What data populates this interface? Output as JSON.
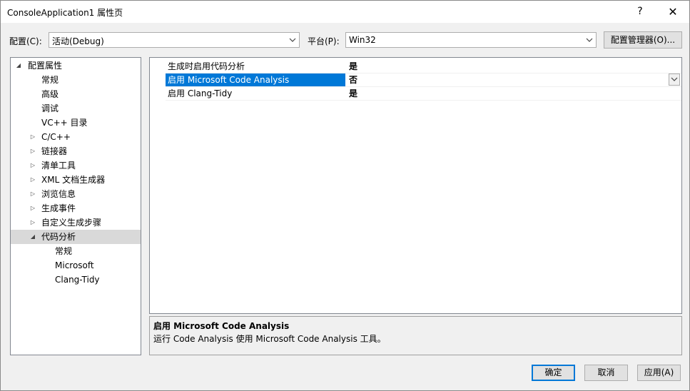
{
  "window": {
    "title": "ConsoleApplication1 属性页",
    "help_glyph": "?",
    "close_glyph": "✕"
  },
  "config": {
    "label": "配置(C):",
    "value": "活动(Debug)"
  },
  "platform": {
    "label": "平台(P):",
    "value": "Win32"
  },
  "config_manager_label": "配置管理器(O)...",
  "tree": {
    "items": [
      {
        "label": "配置属性",
        "expander": "◢"
      },
      {
        "label": "常规"
      },
      {
        "label": "高级"
      },
      {
        "label": "调试"
      },
      {
        "label": "VC++ 目录"
      },
      {
        "label": "C/C++",
        "expander": "▷"
      },
      {
        "label": "链接器",
        "expander": "▷"
      },
      {
        "label": "清单工具",
        "expander": "▷"
      },
      {
        "label": "XML 文档生成器",
        "expander": "▷"
      },
      {
        "label": "浏览信息",
        "expander": "▷"
      },
      {
        "label": "生成事件",
        "expander": "▷"
      },
      {
        "label": "自定义生成步骤",
        "expander": "▷"
      },
      {
        "label": "代码分析",
        "expander": "◢"
      },
      {
        "label": "常规"
      },
      {
        "label": "Microsoft"
      },
      {
        "label": "Clang-Tidy"
      }
    ]
  },
  "properties": [
    {
      "name": "生成时启用代码分析",
      "value": "是"
    },
    {
      "name": "启用 Microsoft Code Analysis",
      "value": "否"
    },
    {
      "name": "启用 Clang-Tidy",
      "value": "是"
    }
  ],
  "description": {
    "title": "启用 Microsoft Code Analysis",
    "text": "运行 Code Analysis 使用 Microsoft Code Analysis 工具。"
  },
  "buttons": {
    "ok": "确定",
    "cancel": "取消",
    "apply": "应用(A)"
  },
  "colors": {
    "accent": "#0078d7",
    "selected_tree": "#d9d9d9"
  }
}
